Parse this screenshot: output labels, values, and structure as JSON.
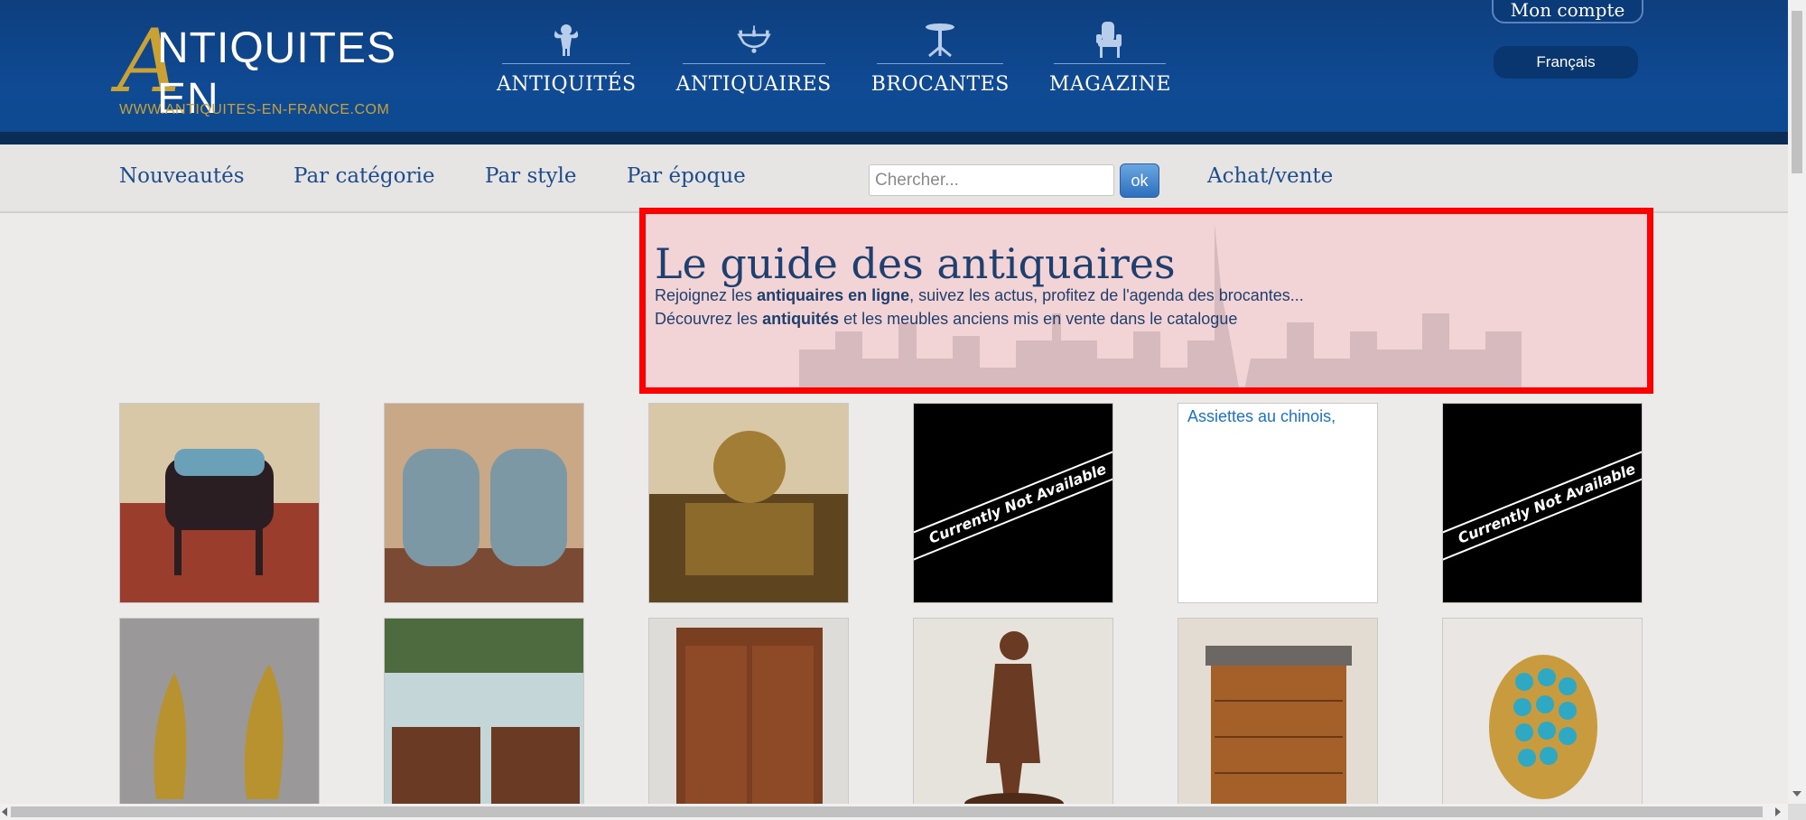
{
  "brand": {
    "logo_letter": "A",
    "line1": "NTIQUITES",
    "line2": "EN FRANCE",
    "url": "WWW.ANTIQUITES-EN-FRANCE.COM"
  },
  "main_nav": [
    {
      "label": "ANTIQUITÉS",
      "icon": "cherub-icon"
    },
    {
      "label": "ANTIQUAIRES",
      "icon": "chandelier-icon"
    },
    {
      "label": "BROCANTES",
      "icon": "pedestal-table-icon"
    },
    {
      "label": "MAGAZINE",
      "icon": "armchair-icon"
    }
  ],
  "account": {
    "label": "Mon compte"
  },
  "language": {
    "selected": "Français"
  },
  "subnav": {
    "items": [
      "Nouveautés",
      "Par catégorie",
      "Par style",
      "Par époque",
      "Achat/vente"
    ],
    "search_placeholder": "Chercher...",
    "ok_label": "ok"
  },
  "hero": {
    "title": "Le guide des antiquaires",
    "line1_pre": "Rejoignez les ",
    "line1_bold": "antiquaires en ligne",
    "line1_post": ", suivez les actus, profitez de l'agenda des brocantes...",
    "line2_pre": "Découvrez les ",
    "line2_bold": "antiquités",
    "line2_post": " et les meubles anciens mis en vente dans le catalogue"
  },
  "listings": [
    {
      "kind": "photo",
      "subject": "chair-back"
    },
    {
      "kind": "photo",
      "subject": "pair-armchairs"
    },
    {
      "kind": "photo",
      "subject": "gilt-carving"
    },
    {
      "kind": "unavailable",
      "text": "Currently Not Available"
    },
    {
      "kind": "broken",
      "alt": "Assiettes au chinois,"
    },
    {
      "kind": "unavailable",
      "text": "Currently Not Available"
    },
    {
      "kind": "photo",
      "subject": "bronze-andirons"
    },
    {
      "kind": "photo",
      "subject": "pair-sideboards"
    },
    {
      "kind": "photo",
      "subject": "armoire"
    },
    {
      "kind": "photo",
      "subject": "bronze-statue"
    },
    {
      "kind": "photo",
      "subject": "chest-of-drawers"
    },
    {
      "kind": "photo",
      "subject": "turquoise-ring"
    }
  ],
  "colors": {
    "header": "#0f4a93",
    "gold": "#c9a135",
    "link": "#1f4c8c",
    "highlight": "#ff0000"
  }
}
